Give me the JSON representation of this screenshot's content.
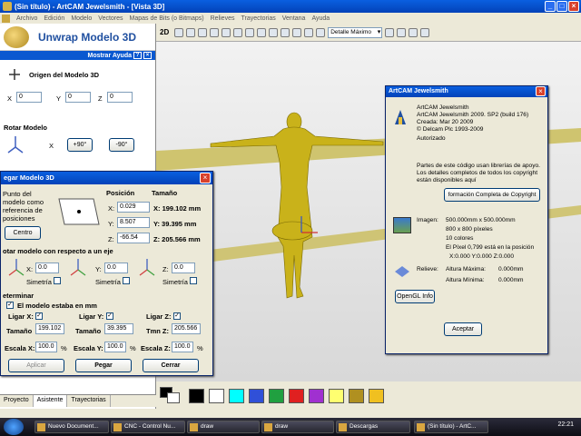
{
  "window": {
    "title": "(Sin título) - ArtCAM Jewelsmith - [Vista 3D]"
  },
  "menu": [
    "Archivo",
    "Edición",
    "Modelo",
    "Vectores",
    "Mapas de Bits (o Bitmaps)",
    "Relieves",
    "Trayectorias",
    "Ventana",
    "Ayuda"
  ],
  "left_panel": {
    "title": "Unwrap Modelo 3D",
    "help": "Mostrar Ayuda",
    "origin_section": "Origen del Modelo 3D",
    "x_label": "X",
    "x_value": "0",
    "y_label": "Y",
    "y_value": "0",
    "z_label": "Z",
    "z_value": "0",
    "rotate_section": "Rotar Modelo",
    "rot_x_label": "X",
    "rot_plus": "+90°",
    "rot_minus": "-90°",
    "tabs": [
      "Proyecto",
      "Asistente",
      "Trayectorias"
    ]
  },
  "dialog": {
    "title": "egar Modelo 3D",
    "point_text": "Punto del modelo como referencia de posiciones",
    "position_header": "Posición",
    "size_header": "Tamaño",
    "pos_x_label": "X:",
    "pos_x": "0.029",
    "size_x": "X: 199.102 mm",
    "pos_y_label": "Y:",
    "pos_y": "8.507",
    "size_y": "Y: 39.395 mm",
    "pos_z_label": "Z:",
    "pos_z": "-66.54",
    "size_z": "Z: 205.566 mm",
    "center_button": "Centro",
    "rotate_about_axis": "otar modelo con respecto a un eje",
    "rx_label": "X:",
    "rx": "0.0",
    "ry_label": "Y:",
    "ry": "0.0",
    "rz_label": "Z:",
    "rz": "0.0",
    "symmetry": "Simetría",
    "determine": "eterminar",
    "model_in_mm": "El modelo estaba en mm",
    "link_x": "Ligar X:",
    "link_y": "Ligar Y:",
    "link_z": "Ligar Z:",
    "size_label": "Tamaño",
    "size_x_val": "199.102",
    "size_y_val": "39.395",
    "tmn_z_label": "Tmn Z:",
    "size_z_val": "205.566",
    "scale_x_label": "Escala X:",
    "scale_x": "100.0",
    "scale_y_label": "Escala Y:",
    "scale_y": "100.0",
    "scale_z_label": "Escala Z:",
    "scale_z": "100.0",
    "percent": "%",
    "apply_button": "Aplicar",
    "paste_button": "Pegar",
    "close_button": "Cerrar"
  },
  "toolbar": {
    "view_label": "2D",
    "detail_select": "Detalle Máximo"
  },
  "about": {
    "title": "ArtCAM Jewelsmith",
    "product": "ArtCAM Jewelsmith",
    "version": "ArtCAM Jewelsmith 2009. SP2 (build 176)",
    "created": "Creada: Mar 20 2009",
    "copyright": "© Delcam Plc 1993-2009",
    "authorized": "Autorizado",
    "notice_1": "Partes de este código usan librerías de apoyo.",
    "notice_2": "Los detalles completos de todos los copyright",
    "notice_3": "están disponibles aquí",
    "copyright_button": "formación Completa de Copyright",
    "image_label": "Imagen:",
    "image_value": "500.000mm x 500.000mm",
    "pixels": "800 x 800 píxeles",
    "colors": "10 colores",
    "pixel_pos": "El Píxel 0,799 está en la posición",
    "pixel_coords": "X:0.000  Y:0.000  Z:0.000",
    "relief_label": "Relieve:",
    "max_height_label": "Altura Máxima:",
    "max_height": "0.000mm",
    "min_height_label": "Altura Mínima:",
    "min_height": "0.000mm",
    "opengl_button": "OpenGL Info",
    "accept_button": "Aceptar"
  },
  "palette_colors": [
    "#000000",
    "#ffffff",
    "#00ffff",
    "#3050d8",
    "#20a040",
    "#e02020",
    "#a030d0",
    "#ffff70",
    "#b09020",
    "#f0c020"
  ],
  "taskbar": {
    "items": [
      "Nuevo Document...",
      "CNC - Control Nu...",
      "draw",
      "draw",
      "Descargas",
      "(Sin título) - ArtC..."
    ],
    "clock": "22:21"
  }
}
